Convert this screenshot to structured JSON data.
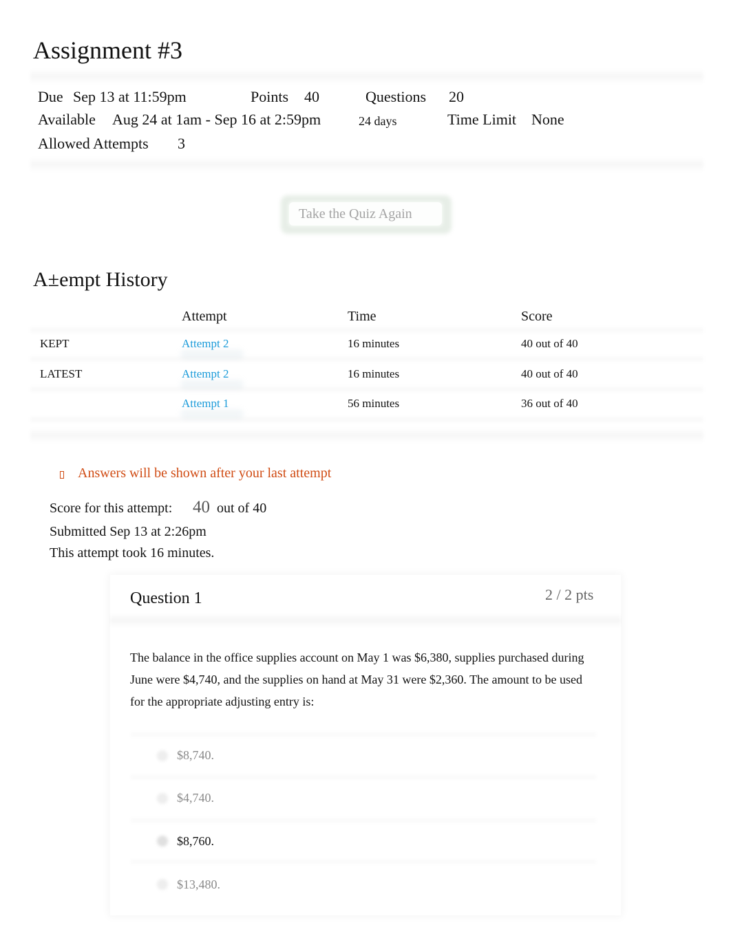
{
  "page": {
    "title": "Assignment #3"
  },
  "details": {
    "due_label": "Due",
    "due_value": "Sep 13 at 11:59pm",
    "points_label": "Points",
    "points_value": "40",
    "questions_label": "Questions",
    "questions_value": "20",
    "available_label": "Available",
    "available_value": "Aug 24 at 1am - Sep 16 at 2:59pm",
    "available_duration": "24 days",
    "time_limit_label": "Time Limit",
    "time_limit_value": "None",
    "attempts_label": "Allowed Attempts",
    "attempts_value": "3"
  },
  "actions": {
    "retake_label": "Take the Quiz Again"
  },
  "history": {
    "heading": "A±empt History",
    "columns": [
      "",
      "Attempt",
      "Time",
      "Score"
    ],
    "rows": [
      {
        "tag": "KEPT",
        "attempt": "Attempt 2",
        "time": "16 minutes",
        "score": "40 out of 40"
      },
      {
        "tag": "LATEST",
        "attempt": "Attempt 2",
        "time": "16 minutes",
        "score": "40 out of 40"
      },
      {
        "tag": "",
        "attempt": "Attempt 1",
        "time": "56 minutes",
        "score": "36 out of 40"
      }
    ]
  },
  "notice": {
    "icon": "warning-icon",
    "text": "Answers will be shown after your last attempt",
    "color": "#d04b13"
  },
  "result": {
    "score_label": "Score for this attempt:",
    "score_value": "40",
    "score_suffix": "out of 40",
    "submitted": "Submitted Sep 13 at 2:26pm",
    "duration": "This attempt took 16 minutes."
  },
  "question": {
    "title": "Question 1",
    "points": "2 / 2 pts",
    "text": "The balance in the office supplies account on May 1 was $6,380, supplies purchased during June were $4,740, and the supplies on hand at May 31 were $2,360. The amount to be used for the appropriate adjusting entry is:",
    "answers": [
      {
        "label": "$8,740.",
        "selected": false
      },
      {
        "label": "$4,740.",
        "selected": false
      },
      {
        "label": "$8,760.",
        "selected": true
      },
      {
        "label": "$13,480.",
        "selected": false
      }
    ]
  },
  "colors": {
    "link": "#1a9ad9",
    "warning": "#d04b13"
  }
}
